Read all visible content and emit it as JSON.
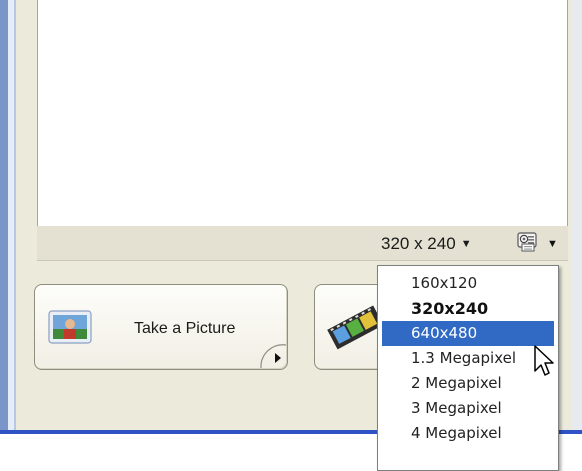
{
  "toolbar": {
    "resolution_label": "320 x 240",
    "settings_icon": "camera-settings-icon"
  },
  "buttons": {
    "take_picture_label": "Take a Picture",
    "take_picture_icon": "photo-icon",
    "record_video_icon": "filmstrip-icon"
  },
  "resolution_menu": {
    "items": [
      {
        "label": "160x120",
        "state": "normal"
      },
      {
        "label": "320x240",
        "state": "current"
      },
      {
        "label": "640x480",
        "state": "hovered"
      },
      {
        "label": "1.3 Megapixel",
        "state": "normal"
      },
      {
        "label": "2 Megapixel",
        "state": "normal"
      },
      {
        "label": "3 Megapixel",
        "state": "normal"
      },
      {
        "label": "4 Megapixel",
        "state": "normal"
      }
    ]
  },
  "colors": {
    "highlight": "#316ac5",
    "panel_bg": "#eceadb",
    "accent_line": "#2f52c6"
  }
}
